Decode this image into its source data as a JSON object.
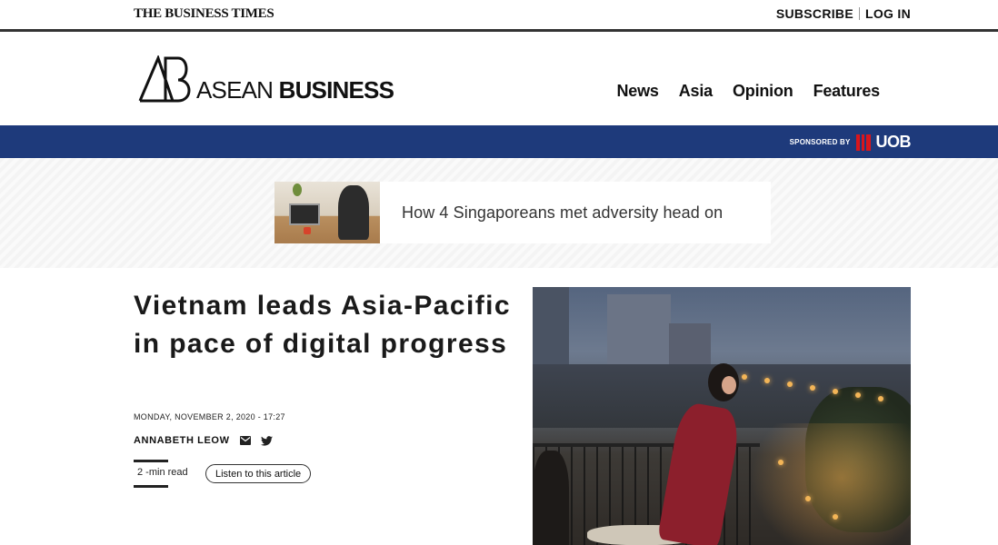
{
  "topbar": {
    "site_name": "THE BUSINESS TIMES",
    "subscribe_label": "SUBSCRIBE",
    "login_label": "LOG IN"
  },
  "brand": {
    "logo_name_light": "ASEAN",
    "logo_name_bold": "BUSINESS",
    "nav": [
      {
        "label": "News"
      },
      {
        "label": "Asia"
      },
      {
        "label": "Opinion"
      },
      {
        "label": "Features"
      }
    ]
  },
  "sponsor": {
    "label": "SPONSORED BY",
    "brand": "UOB",
    "bar_color": "#1e3a7b",
    "brand_color": "#d9151b"
  },
  "banner": {
    "text": "How 4 Singaporeans met adversity head on"
  },
  "article": {
    "headline": "Vietnam leads Asia-Pacific in pace of digital progress",
    "dateline": "MONDAY, NOVEMBER 2, 2020 - 17:27",
    "author": "ANNABETH LEOW",
    "read_time": "2 -min read",
    "listen_label": "Listen to this article"
  },
  "icons": {
    "email": "email-icon",
    "twitter": "twitter-icon"
  }
}
